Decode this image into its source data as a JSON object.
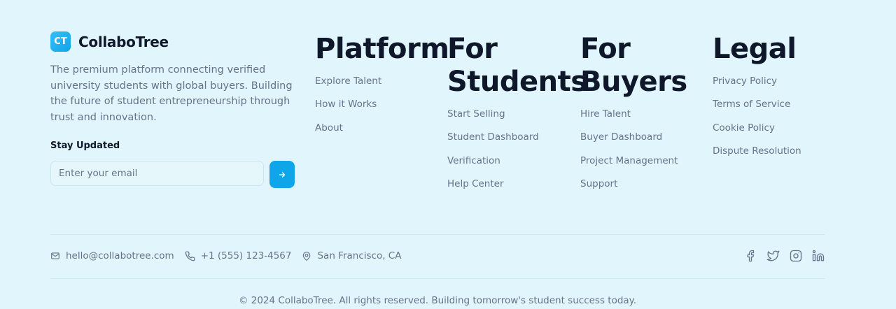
{
  "brand": {
    "logo_text": "CT",
    "name": "CollaboTree",
    "description": "The premium platform connecting verified university students with global buyers. Building the future of student entrepreneurship through trust and innovation."
  },
  "newsletter": {
    "heading": "Stay Updated",
    "placeholder": "Enter your email",
    "submit_icon": "arrow-right-icon"
  },
  "columns": [
    {
      "title": "Platform",
      "links": [
        "Explore Talent",
        "How it Works",
        "About"
      ]
    },
    {
      "title": "For Students",
      "links": [
        "Start Selling",
        "Student Dashboard",
        "Verification",
        "Help Center"
      ]
    },
    {
      "title": "For Buyers",
      "links": [
        "Hire Talent",
        "Buyer Dashboard",
        "Project Management",
        "Support"
      ]
    },
    {
      "title": "Legal",
      "links": [
        "Privacy Policy",
        "Terms of Service",
        "Cookie Policy",
        "Dispute Resolution"
      ]
    }
  ],
  "contact": {
    "email": "hello@collabotree.com",
    "phone": "+1 (555) 123-4567",
    "location": "San Francisco, CA"
  },
  "social": [
    "facebook-icon",
    "twitter-icon",
    "instagram-icon",
    "linkedin-icon"
  ],
  "copyright": "© 2024 CollaboTree. All rights reserved. Building tomorrow's student success today.",
  "colors": {
    "background": "#e0f5fc",
    "accent": "#0ea5e9",
    "heading": "#0f172a",
    "muted": "#64748b"
  }
}
